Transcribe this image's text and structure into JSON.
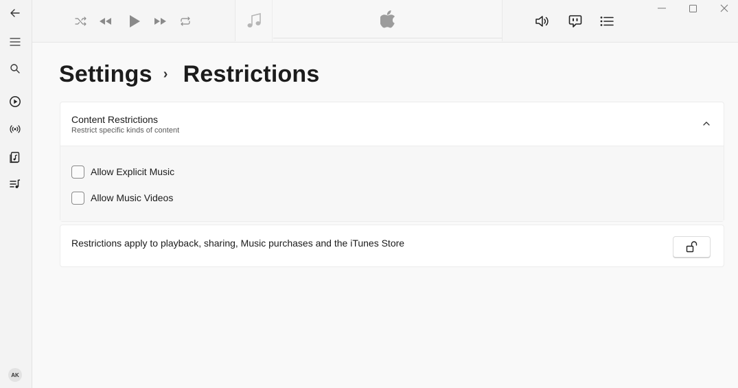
{
  "sidebar": {
    "icons": [
      "back-arrow-icon",
      "hamburger-menu-icon",
      "search-icon",
      "play-circle-icon",
      "radio-broadcast-icon",
      "music-library-icon",
      "playlist-icon"
    ],
    "avatar_initials": "AK"
  },
  "player": {
    "controls": [
      "shuffle-icon",
      "previous-icon",
      "play-icon",
      "next-icon",
      "repeat-icon"
    ],
    "right_controls": [
      "volume-icon",
      "lyrics-icon",
      "queue-list-icon"
    ]
  },
  "page": {
    "breadcrumb_parent": "Settings",
    "breadcrumb_separator": "›",
    "breadcrumb_current": "Restrictions"
  },
  "content_restrictions": {
    "title": "Content Restrictions",
    "subtitle": "Restrict specific kinds of content",
    "options": [
      {
        "label": "Allow Explicit Music",
        "checked": false
      },
      {
        "label": "Allow Music Videos",
        "checked": false
      }
    ]
  },
  "notice": {
    "text": "Restrictions apply to playback, sharing, Music purchases and the iTunes Store"
  },
  "colors": {
    "background": "#f9f9f9",
    "sidebar": "#f3f3f3",
    "panel": "#ffffff",
    "text": "#1a1a1a"
  }
}
